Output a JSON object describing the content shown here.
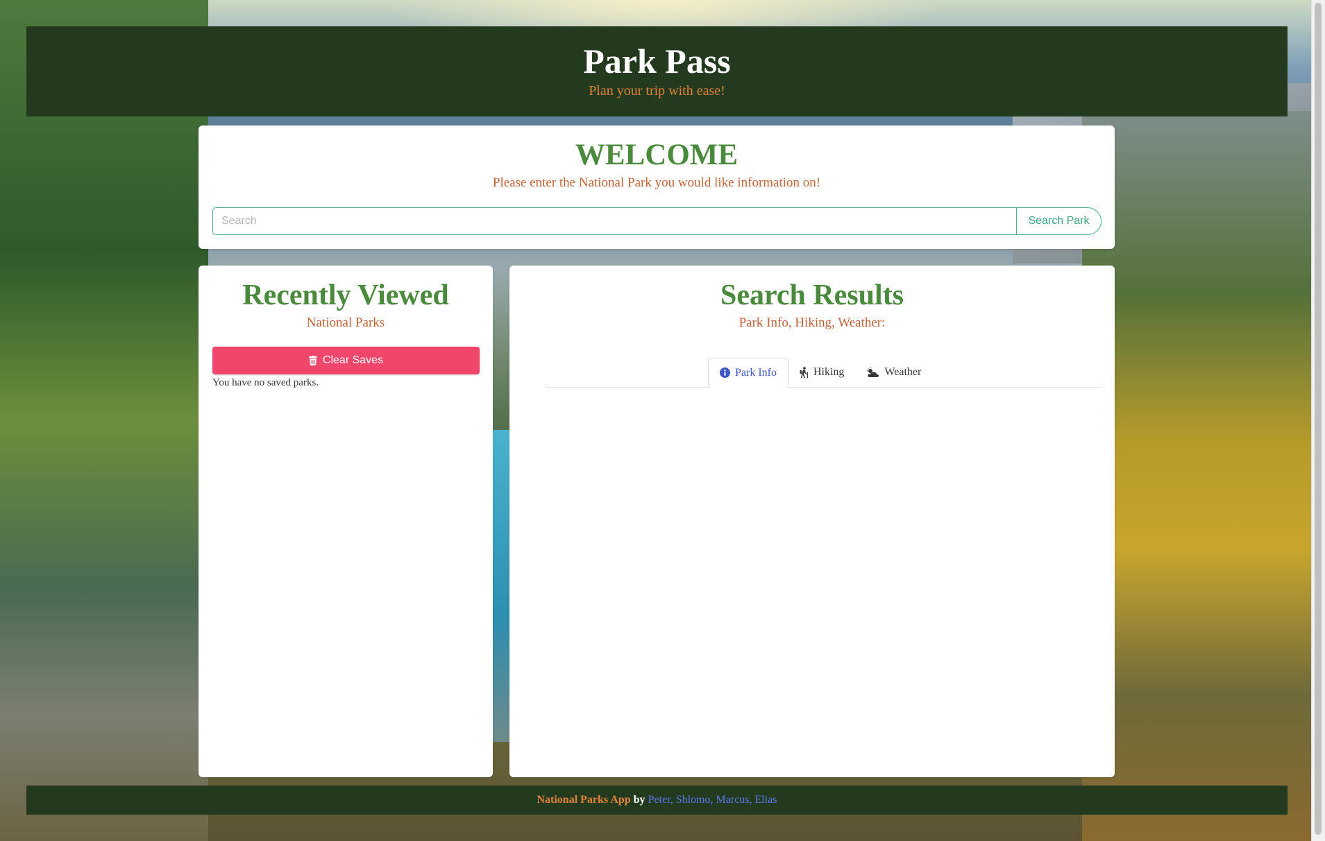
{
  "header": {
    "title": "Park Pass",
    "tagline": "Plan your trip with ease!"
  },
  "welcome": {
    "title": "WELCOME",
    "prompt": "Please enter the National Park you would like information on!",
    "search": {
      "placeholder": "Search",
      "value": "",
      "button_label": "Search Park"
    }
  },
  "recent": {
    "title": "Recently Viewed",
    "subtitle": "National Parks",
    "clear_label": "Clear Saves",
    "empty_text": "You have no saved parks."
  },
  "results": {
    "title": "Search Results",
    "subtitle": "Park Info, Hiking, Weather:",
    "tabs": [
      {
        "label": "Park Info",
        "icon": "info-circle-icon",
        "active": true
      },
      {
        "label": "Hiking",
        "icon": "hiking-icon",
        "active": false
      },
      {
        "label": "Weather",
        "icon": "cloud-sun-icon",
        "active": false
      }
    ]
  },
  "footer": {
    "app_name": "National Parks App",
    "by": "by",
    "authors": "Peter, Shlomo, Marcus, Elias"
  },
  "colors": {
    "header_bg": "#233a1e",
    "title_green": "#4a8a3c",
    "accent_orange": "#c0633a",
    "clear_button": "#f0466b",
    "search_border": "#4caf91",
    "tab_active": "#3e56c4",
    "author_link": "#5b78e8"
  }
}
